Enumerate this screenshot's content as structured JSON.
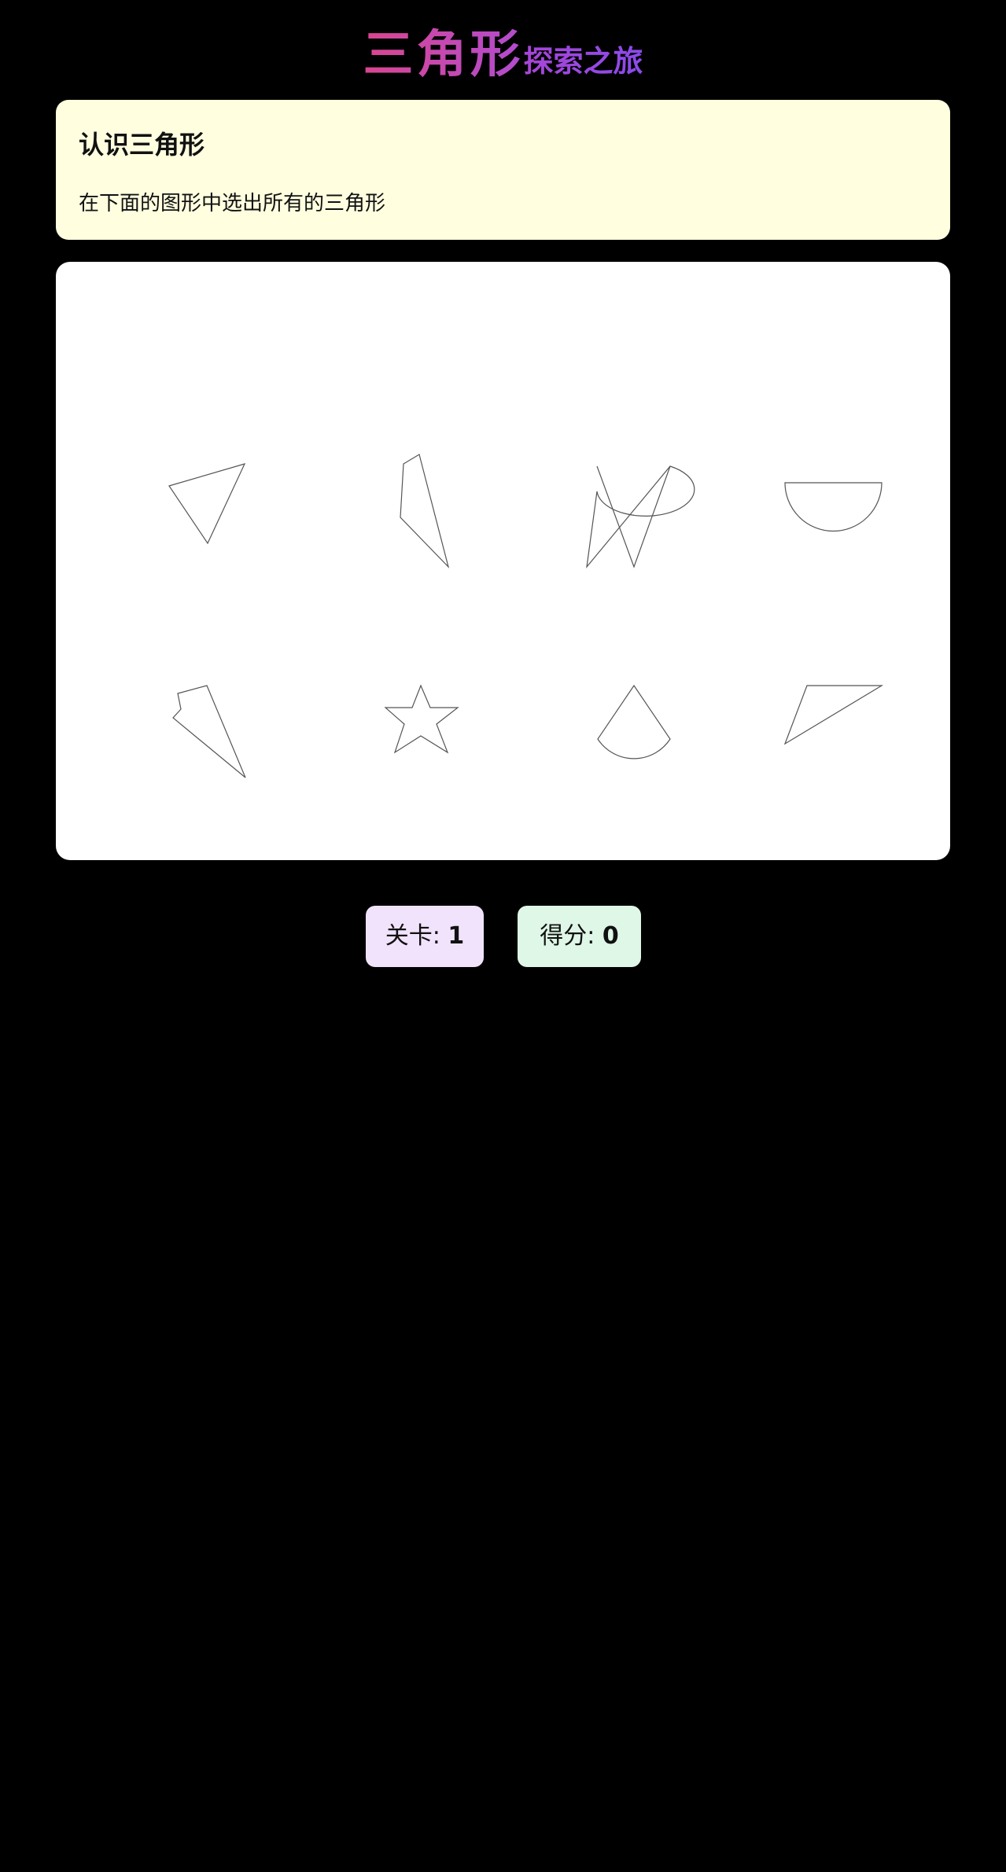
{
  "header": {
    "title_main": "三角形",
    "title_sub": "探索之旅"
  },
  "task": {
    "title": "认识三角形",
    "description": "在下面的图形中选出所有的三角形"
  },
  "shapes": [
    {
      "id": "shape-1",
      "kind": "triangle"
    },
    {
      "id": "shape-2",
      "kind": "quadrilateral"
    },
    {
      "id": "shape-3",
      "kind": "curved-v"
    },
    {
      "id": "shape-4",
      "kind": "semicircle"
    },
    {
      "id": "shape-5",
      "kind": "notched-triangle"
    },
    {
      "id": "shape-6",
      "kind": "star"
    },
    {
      "id": "shape-7",
      "kind": "sector"
    },
    {
      "id": "shape-8",
      "kind": "triangle"
    }
  ],
  "status": {
    "level_label": "关卡:",
    "level_value": "1",
    "score_label": "得分:",
    "score_value": "0"
  },
  "colors": {
    "background": "#000000",
    "task_card": "#ffffe0",
    "board": "#ffffff",
    "level_badge": "#f1e3fc",
    "score_badge": "#dff7e6",
    "title_gradient_start": "#d9468f",
    "title_gradient_end": "#8a4bea"
  }
}
